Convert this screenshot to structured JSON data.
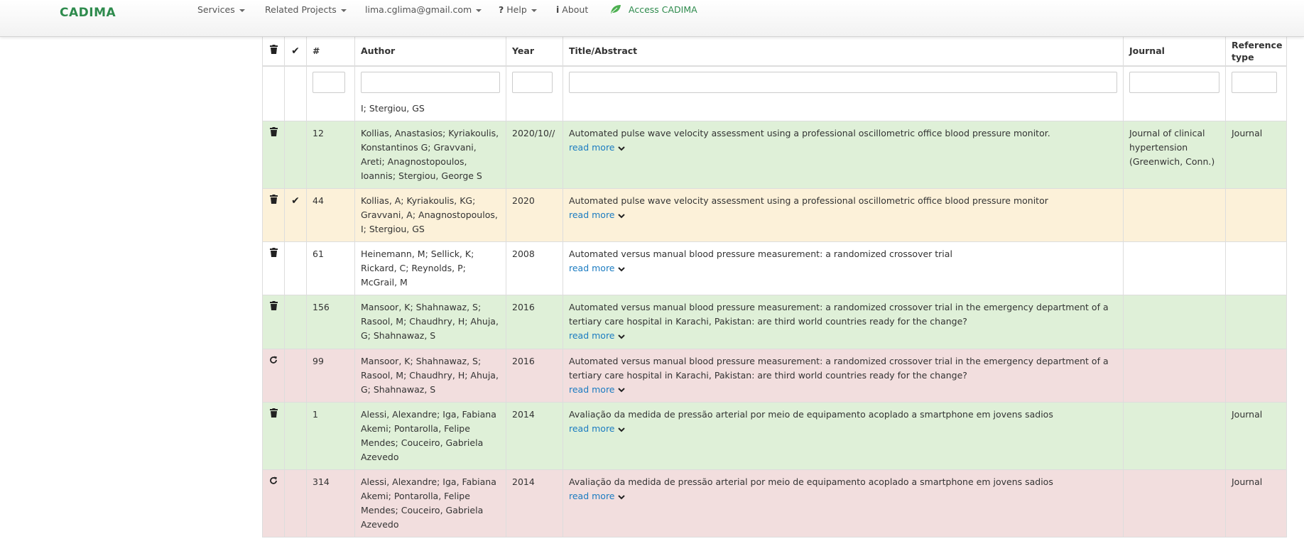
{
  "nav": {
    "brand": "CADIMA",
    "services": "Services",
    "related_projects": "Related Projects",
    "user_email": "lima.cglima@gmail.com",
    "help": "Help",
    "about": "About",
    "access": "Access CADIMA"
  },
  "table": {
    "headers": {
      "delete": "trash-icon",
      "check": "check-icon",
      "num": "#",
      "author": "Author",
      "year": "Year",
      "title": "Title/Abstract",
      "journal": "Journal",
      "reftype": "Reference type"
    },
    "filter_fragment": "I; Stergiou, GS",
    "read_more_label": "read more",
    "rows": [
      {
        "action": "trash-icon",
        "checked": false,
        "num": "12",
        "author": "Kollias, Anastasios; Kyriakoulis, Konstantinos G; Gravvani, Areti; Anagnostopoulos, Ioannis; Stergiou, George S",
        "year": "2020/10//",
        "title": "Automated pulse wave velocity assessment using a professional oscillometric office blood pressure monitor.",
        "journal": "Journal of clinical hypertension (Greenwich, Conn.)",
        "reftype": "Journal",
        "status_color": "#dff0d8"
      },
      {
        "action": "trash-icon",
        "checked": true,
        "num": "44",
        "author": "Kollias, A; Kyriakoulis, KG; Gravvani, A; Anagnostopoulos, I; Stergiou, GS",
        "year": "2020",
        "title": "Automated pulse wave velocity assessment using a professional oscillometric office blood pressure monitor",
        "journal": "",
        "reftype": "",
        "status_color": "#fcf1d9"
      },
      {
        "action": "trash-icon",
        "checked": false,
        "num": "61",
        "author": "Heinemann, M; Sellick, K; Rickard, C; Reynolds, P; McGrail, M",
        "year": "2008",
        "title": "Automated versus manual blood pressure measurement: a randomized crossover trial",
        "journal": "",
        "reftype": "",
        "status_color": "#ffffff"
      },
      {
        "action": "trash-icon",
        "checked": false,
        "num": "156",
        "author": "Mansoor, K; Shahnawaz, S; Rasool, M; Chaudhry, H; Ahuja, G; Shahnawaz, S",
        "year": "2016",
        "title": "Automated versus manual blood pressure measurement: a randomized crossover trial in the emergency department of a tertiary care hospital in Karachi, Pakistan: are third world countries ready for the change?",
        "journal": "",
        "reftype": "",
        "status_color": "#dff0d8"
      },
      {
        "action": "refresh-icon",
        "checked": false,
        "num": "99",
        "author": "Mansoor, K; Shahnawaz, S; Rasool, M; Chaudhry, H; Ahuja, G; Shahnawaz, S",
        "year": "2016",
        "title": "Automated versus manual blood pressure measurement: a randomized crossover trial in the emergency department of a tertiary care hospital in Karachi, Pakistan: are third world countries ready for the change?",
        "journal": "",
        "reftype": "",
        "status_color": "#f2dede"
      },
      {
        "action": "trash-icon",
        "checked": false,
        "num": "1",
        "author": "Alessi, Alexandre; Iga, Fabiana Akemi; Pontarolla, Felipe Mendes; Couceiro, Gabriela Azevedo",
        "year": "2014",
        "title": "Avaliação da medida de pressão arterial por meio de equipamento acoplado a smartphone em jovens sadios",
        "journal": "",
        "reftype": "Journal",
        "status_color": "#dff0d8"
      },
      {
        "action": "refresh-icon",
        "checked": false,
        "num": "314",
        "author": "Alessi, Alexandre; Iga, Fabiana Akemi; Pontarolla, Felipe Mendes; Couceiro, Gabriela Azevedo",
        "year": "2014",
        "title": "Avaliação da medida de pressão arterial por meio de equipamento acoplado a smartphone em jovens sadios",
        "journal": "",
        "reftype": "Journal",
        "status_color": "#f2dede"
      }
    ]
  }
}
